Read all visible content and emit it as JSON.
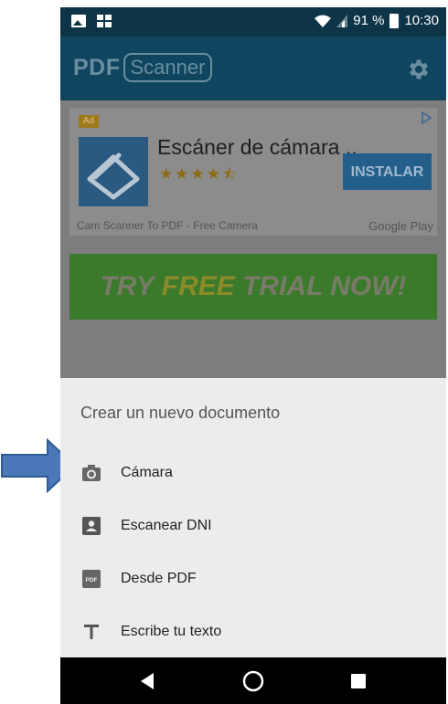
{
  "status_bar": {
    "battery": "91 %",
    "time": "10:30"
  },
  "app_bar": {
    "title_main": "PDF",
    "title_boxed": "Scanner"
  },
  "ad": {
    "tag": "Ad",
    "title": "Escáner de cámara ..",
    "stars": "★★★★⯪",
    "rating": 4.5,
    "install_label": "INSTALAR",
    "description": "Cam Scanner To PDF - Free Camera",
    "store": "Google Play"
  },
  "trial_banner": {
    "part1": "TRY ",
    "part2": "FREE",
    "part3": " TRIAL NOW!"
  },
  "sheet": {
    "title": "Crear un nuevo documento",
    "items": [
      {
        "label": "Cámara",
        "icon": "camera-icon"
      },
      {
        "label": "Escanear DNI",
        "icon": "id-card-icon"
      },
      {
        "label": "Desde PDF",
        "icon": "pdf-icon"
      },
      {
        "label": "Escribe tu texto",
        "icon": "text-icon"
      }
    ]
  },
  "colors": {
    "status_bar": "#0d3447",
    "app_bar": "#10455f",
    "sheet_bg": "#ececec",
    "pointer_arrow": "#4a78b8"
  }
}
